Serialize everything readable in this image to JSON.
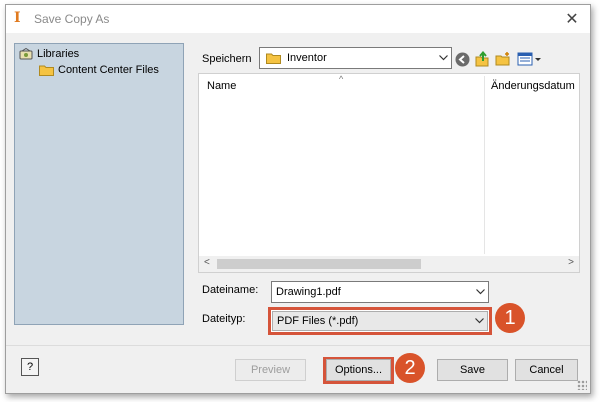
{
  "window": {
    "title": "Save Copy As",
    "close_glyph": "✕"
  },
  "sidebar": {
    "items": [
      {
        "label": "Libraries",
        "icon": "library-icon"
      },
      {
        "label": "Content Center Files",
        "icon": "folder-icon"
      }
    ]
  },
  "location": {
    "label": "Speichern",
    "value": "Inventor"
  },
  "toolbar": {
    "icons": [
      "back-icon",
      "up-folder-icon",
      "new-folder-icon",
      "view-menu-icon"
    ]
  },
  "file_list": {
    "columns": [
      "Name",
      "Änderungsdatum"
    ],
    "rows": []
  },
  "filename": {
    "label": "Dateiname:",
    "value": "Drawing1.pdf"
  },
  "filetype": {
    "label": "Dateityp:",
    "value": "PDF Files (*.pdf)"
  },
  "buttons": {
    "help": "?",
    "preview": "Preview",
    "options": "Options...",
    "save": "Save",
    "cancel": "Cancel"
  },
  "annotations": {
    "badge_1": "1",
    "badge_2": "2"
  },
  "colors": {
    "highlight": "#d5543a",
    "badge": "#d9532a",
    "sidebar_bg": "#c8d5e0",
    "folder": "#f5c342"
  }
}
